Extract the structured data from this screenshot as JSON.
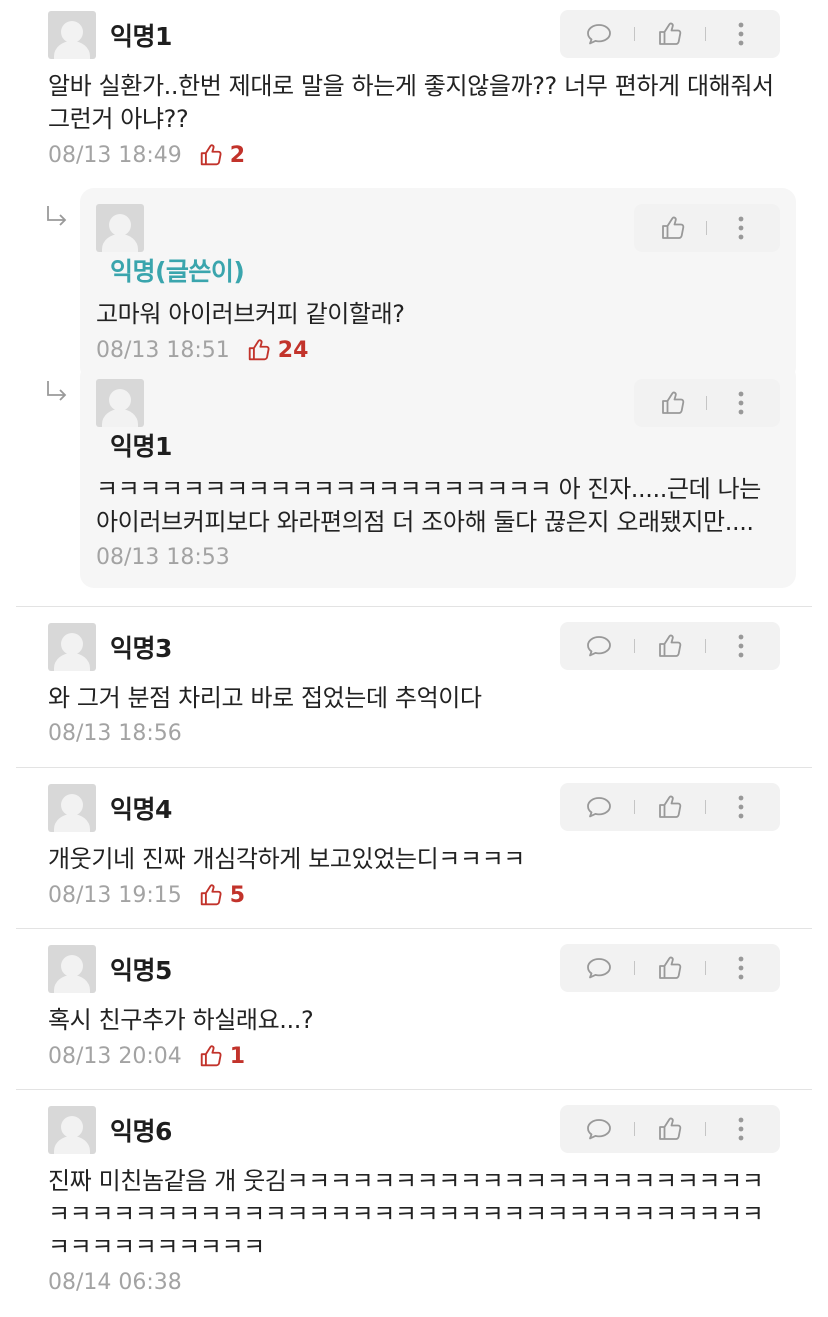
{
  "comments": [
    {
      "name": "익명1",
      "text": "알바 실환가..한번 제대로 말을 하는게 좋지않을까?? 너무 편하게 대해줘서 그런거 아냐??",
      "date": "08/13 18:49",
      "likes": "2"
    },
    {
      "name": "익명(글쓴이)",
      "text": "고마워 아이러브커피 같이할래?",
      "date": "08/13 18:51",
      "likes": "24"
    },
    {
      "name": "익명1",
      "text": "ㅋㅋㅋㅋㅋㅋㅋㅋㅋㅋㅋㅋㅋㅋㅋㅋㅋㅋㅋㅋㅋ 아 진자.....근데 나는 아이러브커피보다 와라편의점 더 조아해 둘다 끊은지 오래됐지만....",
      "date": "08/13 18:53"
    },
    {
      "name": "익명3",
      "text": "와 그거  분점 차리고 바로 접었는데 추억이다",
      "date": "08/13 18:56"
    },
    {
      "name": "익명4",
      "text": "개웃기네 진짜 개심각하게 보고있었는디ㅋㅋㅋㅋ",
      "date": "08/13 19:15",
      "likes": "5"
    },
    {
      "name": "익명5",
      "text": "혹시 친구추가 하실래요...?",
      "date": "08/13 20:04",
      "likes": "1"
    },
    {
      "name": "익명6",
      "text": "진짜 미친놈같음 개 웃김ㅋㅋㅋㅋㅋㅋㅋㅋㅋㅋㅋㅋㅋㅋㅋㅋㅋㅋㅋㅋㅋㅋㅋㅋㅋㅋㅋㅋㅋㅋㅋㅋㅋㅋㅋㅋㅋㅋㅋㅋㅋㅋㅋㅋㅋㅋㅋㅋㅋㅋㅋㅋㅋㅋㅋㅋㅋㅋㅋㅋㅋㅋㅋㅋㅋ",
      "date": "08/14 06:38"
    }
  ],
  "icons": {
    "reply": "speech-bubble-icon",
    "like": "thumbs-up-icon",
    "more": "vertical-dots-icon",
    "thread": "reply-arrow-icon"
  },
  "colors": {
    "author": "#3aa5ad",
    "likes": "#c2332b",
    "meta": "#a3a3a3"
  }
}
